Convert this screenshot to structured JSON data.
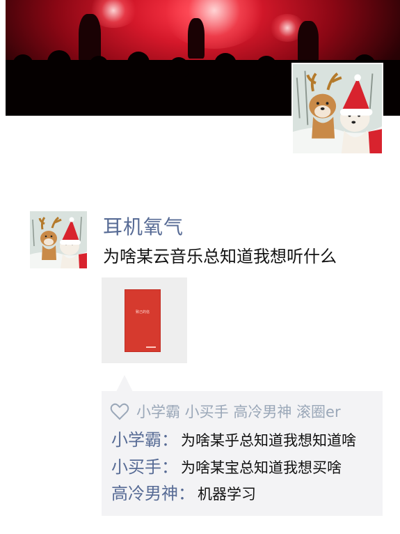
{
  "profile": {
    "nickname": "耳机氧气"
  },
  "post": {
    "text": "为啥某云音乐总知道我想听什么",
    "shared_item_title": "致己的信"
  },
  "likes": {
    "icon": "heart-outline-icon",
    "names": "小学霸 小买手 高冷男神 滚圈er"
  },
  "comments": [
    {
      "author": "小学霸",
      "colon": "：",
      "text": "为啥某乎总知道我想知道啥"
    },
    {
      "author": "小买手",
      "colon": "：",
      "text": "为啥某宝总知道我想买啥"
    },
    {
      "author": "高冷男神",
      "colon": "：",
      "text": "机器学习"
    }
  ],
  "colors": {
    "name_link": "#576b95",
    "comment_bg": "#f3f3f5",
    "liker_text": "#9aa7b8",
    "book_red": "#d63a2e"
  }
}
